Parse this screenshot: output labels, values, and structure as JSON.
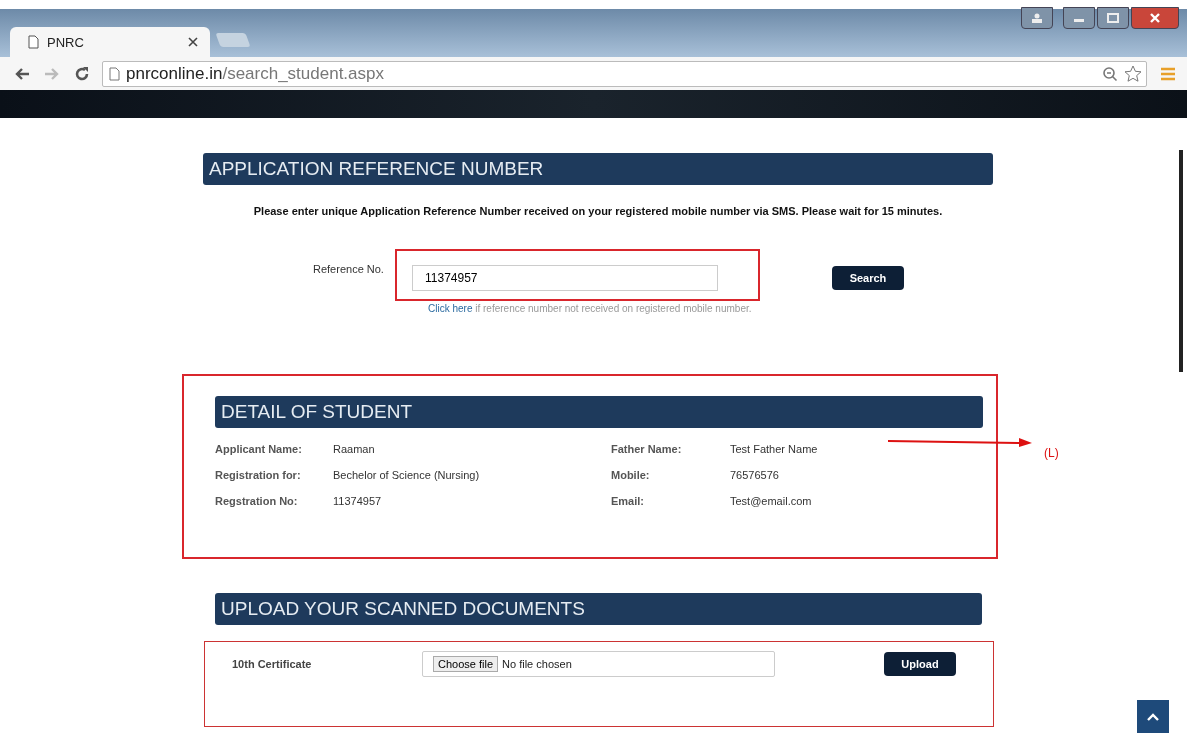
{
  "browser": {
    "tab_title": "PNRC",
    "url_host": "pnrconline.in",
    "url_path": "/search_student.aspx"
  },
  "reference_section": {
    "heading": "APPLICATION REFERENCE NUMBER",
    "instruction": "Please enter unique Application Reference Number received on your registered mobile number via SMS. Please wait for 15 minutes.",
    "field_label": "Reference No.",
    "field_value": "11374957",
    "button": "Search",
    "help_link": "Click here",
    "help_text": " if reference number not received on registered mobile number."
  },
  "student_section": {
    "heading": "DETAIL OF STUDENT",
    "rows": [
      {
        "label": "Applicant Name:",
        "value": "Raaman",
        "label_2": "Father Name:",
        "value_2": "Test Father Name"
      },
      {
        "label": "Registration for:",
        "value": "Bechelor of Science (Nursing)",
        "label_2": "Mobile:",
        "value_2": "76576576"
      },
      {
        "label": "Regstration No:",
        "value": "11374957",
        "label_2": "Email:",
        "value_2": "Test@email.com"
      }
    ]
  },
  "annotation": {
    "label": "(L)"
  },
  "upload_section": {
    "heading": "UPLOAD YOUR SCANNED DOCUMENTS",
    "documents": [
      {
        "label": "10th Certificate",
        "choose_button": "Choose file",
        "file_status": "No file chosen",
        "button": "Upload"
      }
    ]
  }
}
